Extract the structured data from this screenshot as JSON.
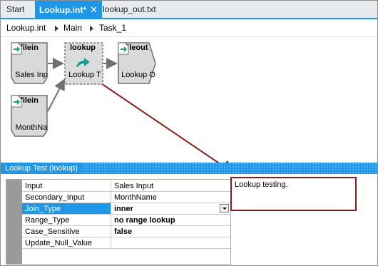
{
  "tabs": [
    {
      "label": "Start"
    },
    {
      "label": "Lookup.int*",
      "active": true
    },
    {
      "label": "lookup_out.txt"
    }
  ],
  "close_symbol": "✕",
  "breadcrumb": [
    "Lookup.int",
    "Main",
    "Task_1"
  ],
  "nodes": {
    "filein1": {
      "title": "filein",
      "label": "Sales Inp",
      "icon": "file-arrow-icon"
    },
    "lookup": {
      "title": "lookup",
      "label": "Lookup T",
      "icon": "lookup-arrow-icon"
    },
    "fileout": {
      "title": "fileout",
      "label": "Lookup O",
      "icon": "file-out-icon"
    },
    "filein2": {
      "title": "filein",
      "label": "MonthNa",
      "icon": "file-arrow-icon"
    }
  },
  "panel": {
    "title": "Lookup Test (lookup)",
    "properties": [
      {
        "key": "Input",
        "value": "Sales Input"
      },
      {
        "key": "Secondary_Input",
        "value": "MonthName"
      },
      {
        "key": "Join_Type",
        "value": "inner"
      },
      {
        "key": "Range_Type",
        "value": "no range lookup"
      },
      {
        "key": "Case_Sensitive",
        "value": "false"
      },
      {
        "key": "Update_Null_Value",
        "value": ""
      }
    ],
    "description": "Lookup testing."
  },
  "colors": {
    "accent": "#1c97ea",
    "annotation": "#8b1a1a"
  }
}
